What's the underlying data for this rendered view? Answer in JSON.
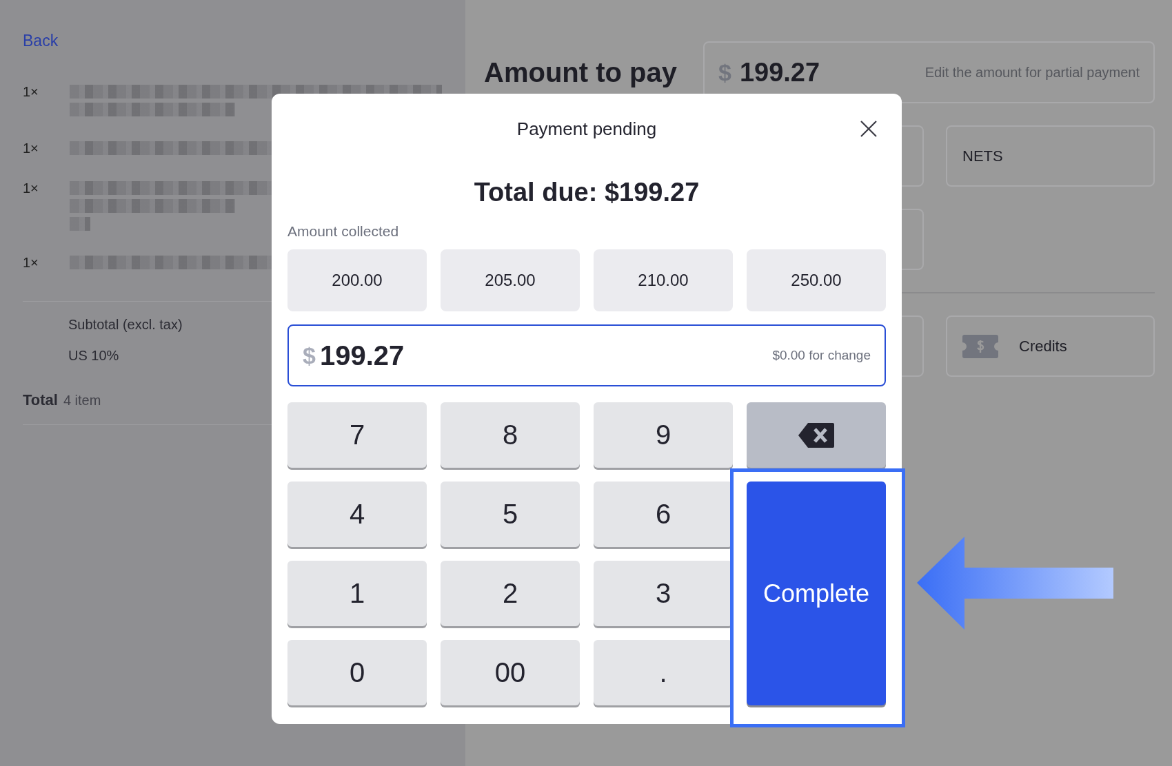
{
  "back_link": "Back",
  "order_items": [
    {
      "quantity": "1×"
    },
    {
      "quantity": "1×"
    },
    {
      "quantity": "1×"
    },
    {
      "quantity": "1×"
    }
  ],
  "summary": {
    "subtotal_label": "Subtotal (excl. tax)",
    "tax_label": "US 10%",
    "total_label": "Total",
    "total_count": "4 item"
  },
  "payment": {
    "title": "Amount to pay",
    "currency": "$",
    "amount": "199.27",
    "hint": "Edit the amount for partial payment"
  },
  "payment_groups": [
    [
      {
        "kind": "covered"
      },
      {
        "kind": "text",
        "label": "NETS"
      },
      {
        "kind": "covered"
      }
    ],
    [
      {
        "kind": "covered"
      },
      {
        "kind": "ticket",
        "label": "Credits"
      }
    ]
  ],
  "modal": {
    "title": "Payment pending",
    "total_due": "Total due: $199.27",
    "amount_collected_label": "Amount collected",
    "quick_amounts": [
      "200.00",
      "205.00",
      "210.00",
      "250.00"
    ],
    "input": {
      "currency": "$",
      "value": "199.27",
      "change": "$0.00 for change"
    },
    "keys": [
      {
        "kind": "digit",
        "label": "7"
      },
      {
        "kind": "digit",
        "label": "8"
      },
      {
        "kind": "digit",
        "label": "9"
      },
      {
        "kind": "backspace"
      },
      {
        "kind": "digit",
        "label": "4"
      },
      {
        "kind": "digit",
        "label": "5"
      },
      {
        "kind": "digit",
        "label": "6"
      },
      {
        "kind": "digit",
        "label": "1"
      },
      {
        "kind": "digit",
        "label": "2"
      },
      {
        "kind": "digit",
        "label": "3"
      },
      {
        "kind": "digit",
        "label": "0"
      },
      {
        "kind": "digit",
        "label": "00"
      },
      {
        "kind": "digit",
        "label": "."
      },
      {
        "kind": "complete",
        "label": "Complete",
        "highlighted": true
      }
    ]
  }
}
